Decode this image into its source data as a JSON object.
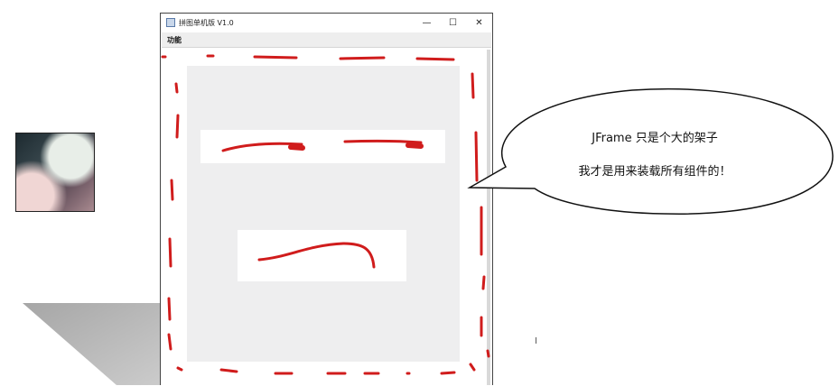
{
  "window": {
    "title": "拼图单机版 V1.0",
    "minimize_glyph": "—",
    "maximize_glyph": "☐",
    "close_glyph": "✕"
  },
  "menubar": {
    "items": [
      {
        "label": "功能"
      }
    ]
  },
  "bubble": {
    "line1": "JFrame 只是个大的架子",
    "line2": "我才是用来装载所有组件的！"
  },
  "icons": {
    "app_icon": "java-cup-icon",
    "cursor": "text-cursor-icon"
  },
  "colors": {
    "annotation_red": "#d01c1c",
    "panel_gray": "#eeeeef"
  },
  "cursor_glyph": "I"
}
